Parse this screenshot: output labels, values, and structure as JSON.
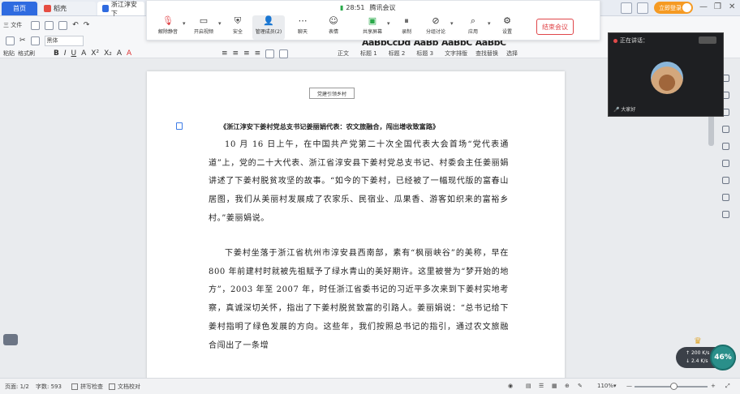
{
  "tabs": [
    {
      "label": "首页"
    },
    {
      "label": "稻壳"
    },
    {
      "label": "浙江淳安下"
    }
  ],
  "account": {
    "login_label": "立即登录"
  },
  "ribbon": {
    "row1": [
      "三 文件",
      "开始",
      "插入"
    ],
    "font_name": "黑体",
    "row2_left": [
      "粘贴",
      "格式刷"
    ],
    "format_glyphs": [
      "B",
      "I",
      "U",
      "A",
      "X²",
      "X₂",
      "A",
      "A"
    ],
    "styles": [
      "AaBbCcDd",
      "AaBb",
      "AaBbC",
      "AaBbC"
    ],
    "style_names": [
      "正文",
      "标题 1",
      "标题 2",
      "标题 3",
      "文字排版",
      "查找替换",
      "选择"
    ]
  },
  "meeting": {
    "time": "28:51",
    "title": "腾讯会议",
    "buttons": [
      "解除静音",
      "开启视频",
      "安全",
      "管理成员(2)",
      "聊天",
      "表情",
      "共享屏幕",
      "录制",
      "分组讨论",
      "应用",
      "设置"
    ],
    "leave_label": "结束会议"
  },
  "video": {
    "title": "正在讲话：",
    "speaker": "大家好"
  },
  "document": {
    "header_tag": "党建引领乡村",
    "title": "《浙江淳安下姜村党总支书记姜丽娟代表：农文旅融合，闯出增收致富路》",
    "paragraph1": "10 月 16 日上午，在中国共产党第二十次全国代表大会首场“党代表通道”上，党的二十大代表、浙江省淳安县下姜村党总支书记、村委会主任姜丽娟讲述了下姜村脱贫攻坚的故事。“如今的下姜村，已经被了一幅现代版的富春山居图，我们从美丽村发展成了农家乐、民宿业、瓜果香、游客如织来的富裕乡村。”姜丽娟说。",
    "paragraph2": "下姜村坐落于浙江省杭州市淳安县西南部，素有“枫丽峡谷”的美称，早在 800 年前建村时就被先祖赋予了绿水青山的美好期许。这里被誉为“梦开始的地方”，2003 年至 2007 年，时任浙江省委书记的习近平多次来到下姜村实地考察，真诚深切关怀，指出了下姜村脱贫致富的引路人。姜丽娟说：“总书记给下姜村指明了绿色发展的方向。这些年，我们按照总书记的指引，通过农文旅融合闯出了一条增"
  },
  "network": {
    "up": "200 K/s",
    "down": "2.4 K/s",
    "battery": "46%"
  },
  "status": {
    "page": "页面: 1/2",
    "words": "字数: 593",
    "spell": "拼写检查",
    "align": "文档校对",
    "zoom": "110%"
  },
  "colors": {
    "accent": "#2f6be0",
    "leave": "#e0464a",
    "login": "#f59a23",
    "battery": "#2a8f8a"
  }
}
